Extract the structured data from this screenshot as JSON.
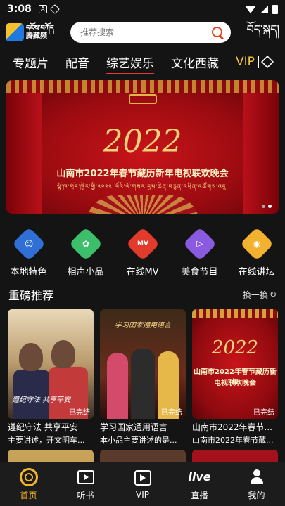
{
  "status_bar": {
    "time": "3:08",
    "icon_a": "A"
  },
  "header": {
    "logo_text_top": "དངོས་བཀོད",
    "logo_text_bottom": "腾藏频",
    "search_placeholder": "推荐搜索",
    "tibetan_toggle": "བོད་སྐད།"
  },
  "tabs": [
    {
      "label": "专题片"
    },
    {
      "label": "配音"
    },
    {
      "label": "综艺娱乐",
      "active": true
    },
    {
      "label": "文化西藏"
    },
    {
      "label": "VIP"
    }
  ],
  "banner": {
    "year": "2022",
    "title": "山南市2022年春节藏历新年电视联欢晚会",
    "subtitle": "ལྷོ་ཁ་གྲོང་ཁྱེར་གྱི་༢༠༢༢ ལོའི་ལོ་གསར་དུས་ཆེན་བརྙན་འཕྲིན་འཚོགས་འདུ།"
  },
  "categories": [
    {
      "label": "本地特色",
      "icon": "local-feature-icon",
      "color": "#2f6fd6"
    },
    {
      "label": "相声小品",
      "icon": "comedy-icon",
      "color": "#3cbf6a"
    },
    {
      "label": "在线MV",
      "icon": "mv-icon",
      "color": "#e23a2b",
      "glyph": "MV"
    },
    {
      "label": "美食节目",
      "icon": "food-icon",
      "color": "#8a5be0"
    },
    {
      "label": "在线讲坛",
      "icon": "lecture-icon",
      "color": "#f2b230"
    }
  ],
  "section": {
    "title": "重磅推荐",
    "refresh_label": "换一换"
  },
  "cards": [
    {
      "title": "遵纪守法 共享平安",
      "subtitle": "主要讲述，开文明车...",
      "tag": "已完结",
      "thumb_caption": "遵纪守法 共享平安"
    },
    {
      "title": "学习国家通用语言",
      "subtitle": "本小品主要讲述的是...",
      "tag": "已完结",
      "thumb_caption": "学习国家通用语言"
    },
    {
      "title": "山南市2022年春节...",
      "subtitle": "山南市2022年春节藏...",
      "tag": "已完结",
      "thumb_year": "2022",
      "thumb_line1": "山南市2022年春节藏历新年",
      "thumb_line2": "电视联欢晚会"
    }
  ],
  "bottom_nav": [
    {
      "label": "首页",
      "icon": "home-icon",
      "active": true
    },
    {
      "label": "听书",
      "icon": "audiobook-icon"
    },
    {
      "label": "VIP",
      "icon": "vip-icon"
    },
    {
      "label": "直播",
      "icon": "live-icon",
      "glyph": "live"
    },
    {
      "label": "我的",
      "icon": "user-icon"
    }
  ],
  "colors": {
    "accent": "#f4b52b",
    "vip": "#f7c63a",
    "search": "#e8421c",
    "tab_underline": "#e63a2e"
  }
}
